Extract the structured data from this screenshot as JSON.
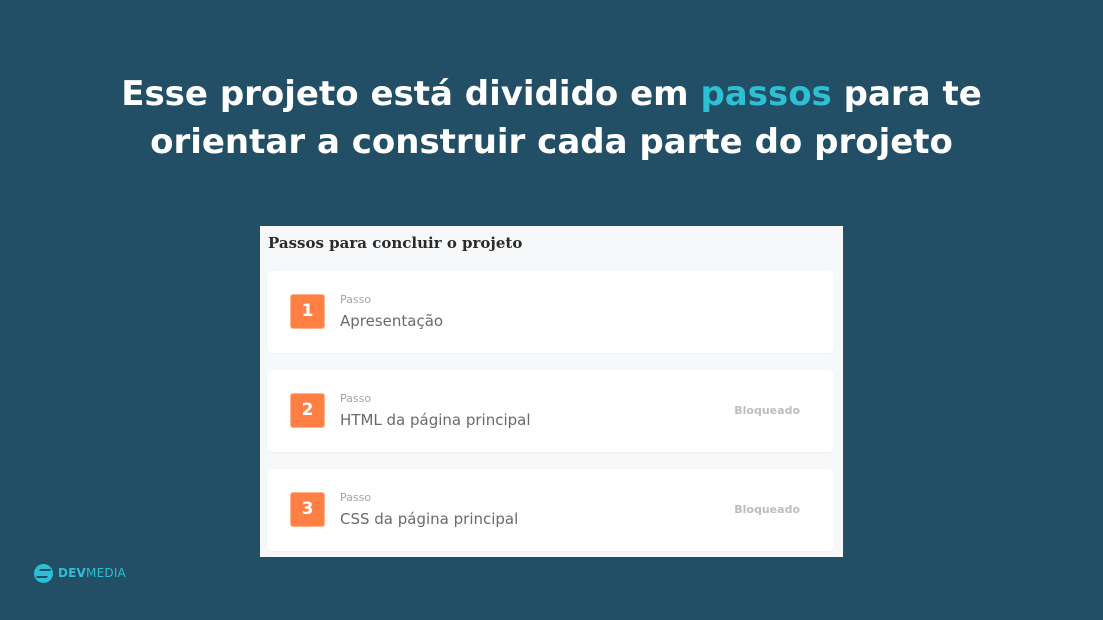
{
  "headline": {
    "line1_before": "Esse projeto está dividido em ",
    "line1_accent": "passos",
    "line1_after": " para te",
    "line2": "orientar a construir cada parte do projeto"
  },
  "panel": {
    "title": "Passos para concluir o projeto",
    "steps": [
      {
        "number": "1",
        "kicker": "Passo",
        "title": "Apresentação",
        "status": ""
      },
      {
        "number": "2",
        "kicker": "Passo",
        "title": "HTML da página principal",
        "status": "Bloqueado"
      },
      {
        "number": "3",
        "kicker": "Passo",
        "title": "CSS da página principal",
        "status": "Bloqueado"
      }
    ]
  },
  "logo": {
    "icon": "devmedia-logo-icon",
    "text_bold": "DEV",
    "text_light": "MEDIA"
  },
  "colors": {
    "background": "#224f66",
    "accent": "#2dbfd3",
    "step_badge": "#ff7f45"
  }
}
